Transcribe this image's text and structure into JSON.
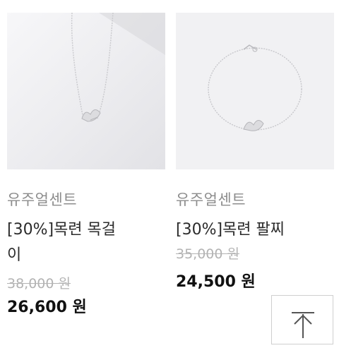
{
  "products": [
    {
      "brand": "유주얼센트",
      "title": "[30%]목련 목걸이",
      "title_line1": "[30%]목련 목걸",
      "title_line2": "이",
      "original_price": "38,000 원",
      "sale_price": "26,600 원"
    },
    {
      "brand": "유주얼센트",
      "title": "[30%]목련 팔찌",
      "original_price": "35,000 원",
      "sale_price": "24,500 원"
    }
  ],
  "scroll_top": {
    "icon": "arrow-up-icon"
  }
}
